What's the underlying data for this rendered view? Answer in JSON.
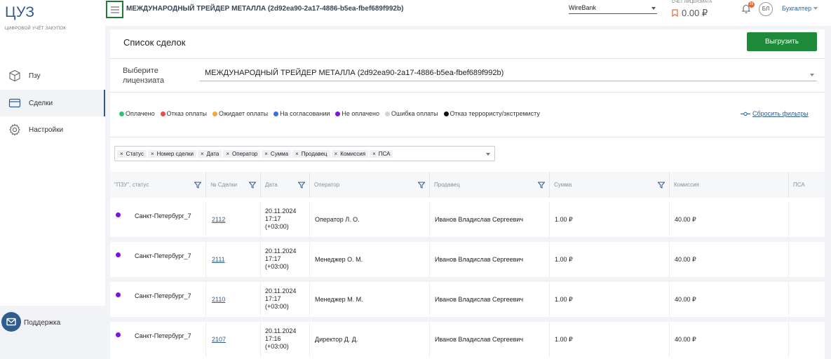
{
  "app": {
    "logo": "ЦУЗ",
    "logo_sub": "ЦИФРОВОЙ УЧЁТ ЗАКУПОК"
  },
  "sidebar": {
    "items": [
      {
        "label": "Пзу",
        "icon": "cube-icon"
      },
      {
        "label": "Сделки",
        "icon": "card-icon",
        "active": true
      },
      {
        "label": "Настройки",
        "icon": "gear-icon"
      }
    ],
    "support_label": "Поддержка"
  },
  "header": {
    "title": "МЕЖДУНАРОДНЫЙ ТРЕЙДЕР МЕТАЛЛА (2d92ea90-2a17-4886-b5ea-fbef689f992b)",
    "bank": "WireBank",
    "account_label": "СЧЁТ ЛИЦЕНЗИАТА",
    "account_value": "0.00 ₽",
    "notifications_badge": "29",
    "avatar_initials": "БЛ",
    "role": "Бухгалтер"
  },
  "page": {
    "title": "Список сделок",
    "export_label": "Выгрузить",
    "licensee_label": "Выберите лицензиата",
    "licensee_value": "МЕЖДУНАРОДНЫЙ ТРЕЙДЕР МЕТАЛЛА (2d92ea90-2a17-4886-b5ea-fbef689f992b)"
  },
  "legend": [
    {
      "label": "Оплачено",
      "color": "#2fc27a"
    },
    {
      "label": "Отказ оплаты",
      "color": "#e84b4b"
    },
    {
      "label": "Ожидает оплаты",
      "color": "#f2a93b"
    },
    {
      "label": "На согласовании",
      "color": "#3b6fe0"
    },
    {
      "label": "Не оплачено",
      "color": "#7d13e8"
    },
    {
      "label": "Ошибка оплаты",
      "color": "#d4d4d4"
    },
    {
      "label": "Отказ террористу/экстремисту",
      "color": "#111111"
    }
  ],
  "reset_filters_label": "Сбросить фильтры",
  "columns_selected": [
    "Статус",
    "Номер сделки",
    "Дата",
    "Оператор",
    "Сумма",
    "Продавец",
    "Комиссия",
    "ПСА"
  ],
  "table": {
    "headers": [
      "\"ПЗУ\", статус",
      "№ Сделки",
      "Дата",
      "Оператор",
      "Продавец",
      "Сумма",
      "Комиссия",
      "ПСА"
    ],
    "rows": [
      {
        "pzu": "Санкт-Петербург_7",
        "deal": "2112",
        "date": "20.11.2024",
        "time": "17:17",
        "tz": "(+03:00)",
        "operator": "Оператор Л. О.",
        "seller": "Иванов Владислав Сергеевич",
        "sum": "1.00 ₽",
        "commission": "40.00 ₽",
        "psa": ""
      },
      {
        "pzu": "Санкт-Петербург_7",
        "deal": "2111",
        "date": "20.11.2024",
        "time": "17:17",
        "tz": "(+03:00)",
        "operator": "Менеджер О. М.",
        "seller": "Иванов Владислав Сергеевич",
        "sum": "1.00 ₽",
        "commission": "40.00 ₽",
        "psa": ""
      },
      {
        "pzu": "Санкт-Петербург_7",
        "deal": "2110",
        "date": "20.11.2024",
        "time": "17:17",
        "tz": "(+03:00)",
        "operator": "Менеджер М. М.",
        "seller": "Иванов Владислав Сергеевич",
        "sum": "1.00 ₽",
        "commission": "40.00 ₽",
        "psa": ""
      },
      {
        "pzu": "Санкт-Петербург_7",
        "deal": "2107",
        "date": "20.11.2024",
        "time": "17:16",
        "tz": "(+03:00)",
        "operator": "Директор Д. Д.",
        "seller": "Иванов Владислав Сергеевич",
        "sum": "1.00 ₽",
        "commission": "40.00 ₽",
        "psa": ""
      }
    ]
  }
}
